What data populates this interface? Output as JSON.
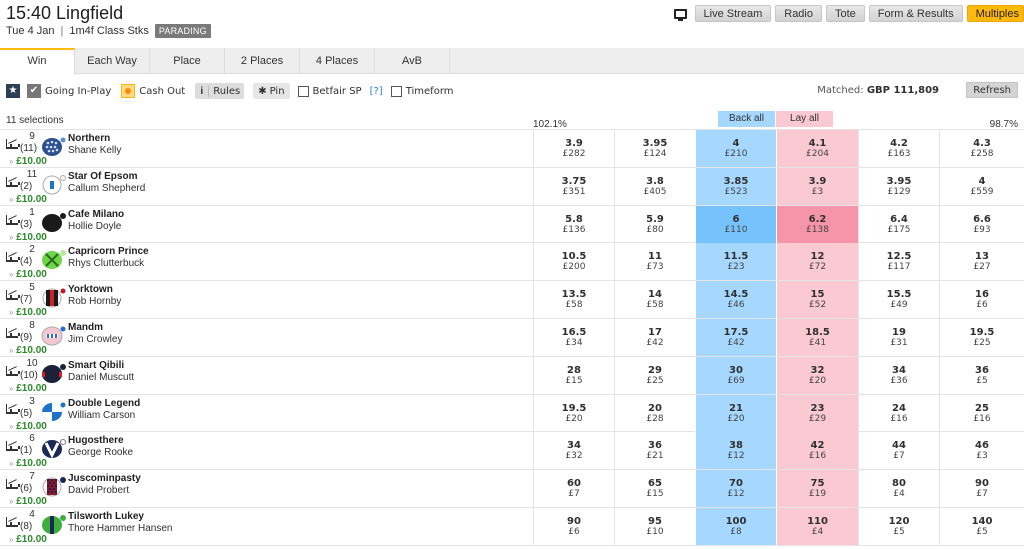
{
  "header": {
    "title": "15:40 Lingfield",
    "date": "Tue 4 Jan",
    "separator": "|",
    "race_class": "1m4f Class Stks",
    "status_badge": "PARADING"
  },
  "top_buttons": {
    "tv_icon": "tv-icon",
    "live_stream": "Live Stream",
    "radio": "Radio",
    "tote": "Tote",
    "form_results": "Form & Results",
    "multiples": "Multiples"
  },
  "tabs": [
    {
      "label": "Win",
      "active": true
    },
    {
      "label": "Each Way"
    },
    {
      "label": "Place"
    },
    {
      "label": "2 Places"
    },
    {
      "label": "4 Places"
    },
    {
      "label": "AvB"
    }
  ],
  "options": {
    "star_icon": "star-icon",
    "going_in_play": "Going In-Play",
    "cash_out": "Cash Out",
    "rules_icon": "i",
    "rules": "Rules",
    "pin_icon": "✱",
    "pin": "Pin",
    "betfair_sp": "Betfair SP",
    "help": "[?]",
    "timeform": "Timeform"
  },
  "market": {
    "matched_label": "Matched:",
    "matched_value": "GBP 111,809",
    "refresh": "Refresh",
    "selections": "11 selections",
    "back_book": "102.1%",
    "lay_book": "98.7%",
    "back_all": "Back all",
    "lay_all": "Lay all"
  },
  "colors": {
    "back": "#a6d8ff",
    "back_best_highlight": "#75c2fd",
    "lay": "#fac9d1",
    "lay_best_highlight": "#f694aa",
    "accent": "#ffb80c",
    "stake_green": "#2b8a2b"
  },
  "runners": [
    {
      "saddle": "9",
      "stall": "(11)",
      "name": "Northern",
      "jockey": "Shane Kelly",
      "stake": "£10.00",
      "silk": "blue-dots",
      "prices": [
        [
          "3.9",
          "£282"
        ],
        [
          "3.95",
          "£124"
        ],
        [
          "4",
          "£210"
        ],
        [
          "4.1",
          "£204"
        ],
        [
          "4.2",
          "£163"
        ],
        [
          "4.3",
          "£258"
        ]
      ]
    },
    {
      "saddle": "11",
      "stall": "(2)",
      "name": "Star Of Epsom",
      "jockey": "Callum Shepherd",
      "stake": "£10.00",
      "silk": "white-blue",
      "prices": [
        [
          "3.75",
          "£351"
        ],
        [
          "3.8",
          "£405"
        ],
        [
          "3.85",
          "£523"
        ],
        [
          "3.9",
          "£3"
        ],
        [
          "3.95",
          "£129"
        ],
        [
          "4",
          "£559"
        ]
      ]
    },
    {
      "saddle": "1",
      "stall": "(3)",
      "name": "Cafe Milano",
      "jockey": "Hollie Doyle",
      "stake": "£10.00",
      "silk": "black",
      "highlight": true,
      "prices": [
        [
          "5.8",
          "£136"
        ],
        [
          "5.9",
          "£80"
        ],
        [
          "6",
          "£110"
        ],
        [
          "6.2",
          "£138"
        ],
        [
          "6.4",
          "£175"
        ],
        [
          "6.6",
          "£93"
        ]
      ]
    },
    {
      "saddle": "2",
      "stall": "(4)",
      "name": "Capricorn Prince",
      "jockey": "Rhys Clutterbuck",
      "stake": "£10.00",
      "silk": "green-cross",
      "prices": [
        [
          "10.5",
          "£200"
        ],
        [
          "11",
          "£73"
        ],
        [
          "11.5",
          "£23"
        ],
        [
          "12",
          "£72"
        ],
        [
          "12.5",
          "£117"
        ],
        [
          "13",
          "£27"
        ]
      ]
    },
    {
      "saddle": "5",
      "stall": "(7)",
      "name": "Yorktown",
      "jockey": "Rob Hornby",
      "stake": "£10.00",
      "silk": "black-red",
      "prices": [
        [
          "13.5",
          "£58"
        ],
        [
          "14",
          "£58"
        ],
        [
          "14.5",
          "£46"
        ],
        [
          "15",
          "£52"
        ],
        [
          "15.5",
          "£49"
        ],
        [
          "16",
          "£6"
        ]
      ]
    },
    {
      "saddle": "8",
      "stall": "(9)",
      "name": "Mandm",
      "jockey": "Jim Crowley",
      "stake": "£10.00",
      "silk": "pink-blue",
      "prices": [
        [
          "16.5",
          "£34"
        ],
        [
          "17",
          "£42"
        ],
        [
          "17.5",
          "£42"
        ],
        [
          "18.5",
          "£41"
        ],
        [
          "19",
          "£31"
        ],
        [
          "19.5",
          "£25"
        ]
      ]
    },
    {
      "saddle": "10",
      "stall": "(10)",
      "name": "Smart Qibili",
      "jockey": "Daniel Muscutt",
      "stake": "£10.00",
      "silk": "navy-red",
      "prices": [
        [
          "28",
          "£15"
        ],
        [
          "29",
          "£25"
        ],
        [
          "30",
          "£69"
        ],
        [
          "32",
          "£20"
        ],
        [
          "34",
          "£36"
        ],
        [
          "36",
          "£5"
        ]
      ]
    },
    {
      "saddle": "3",
      "stall": "(5)",
      "name": "Double Legend",
      "jockey": "William Carson",
      "stake": "£10.00",
      "silk": "blue-white-quarters",
      "prices": [
        [
          "19.5",
          "£20"
        ],
        [
          "20",
          "£28"
        ],
        [
          "21",
          "£20"
        ],
        [
          "23",
          "£29"
        ],
        [
          "24",
          "£16"
        ],
        [
          "25",
          "£16"
        ]
      ]
    },
    {
      "saddle": "6",
      "stall": "(1)",
      "name": "Hugosthere",
      "jockey": "George Rooke",
      "stake": "£10.00",
      "silk": "navy-white-v",
      "prices": [
        [
          "34",
          "£32"
        ],
        [
          "36",
          "£21"
        ],
        [
          "38",
          "£12"
        ],
        [
          "42",
          "£16"
        ],
        [
          "44",
          "£7"
        ],
        [
          "46",
          "£3"
        ]
      ]
    },
    {
      "saddle": "7",
      "stall": "(6)",
      "name": "Juscominpasty",
      "jockey": "David Probert",
      "stake": "£10.00",
      "silk": "maroon-check",
      "prices": [
        [
          "60",
          "£7"
        ],
        [
          "65",
          "£15"
        ],
        [
          "70",
          "£12"
        ],
        [
          "75",
          "£19"
        ],
        [
          "80",
          "£4"
        ],
        [
          "90",
          "£7"
        ]
      ]
    },
    {
      "saddle": "4",
      "stall": "(8)",
      "name": "Tilsworth Lukey",
      "jockey": "Thore Hammer Hansen",
      "stake": "£10.00",
      "silk": "green-navy",
      "prices": [
        [
          "90",
          "£6"
        ],
        [
          "95",
          "£10"
        ],
        [
          "100",
          "£8"
        ],
        [
          "110",
          "£4"
        ],
        [
          "120",
          "£5"
        ],
        [
          "140",
          "£5"
        ]
      ]
    }
  ]
}
